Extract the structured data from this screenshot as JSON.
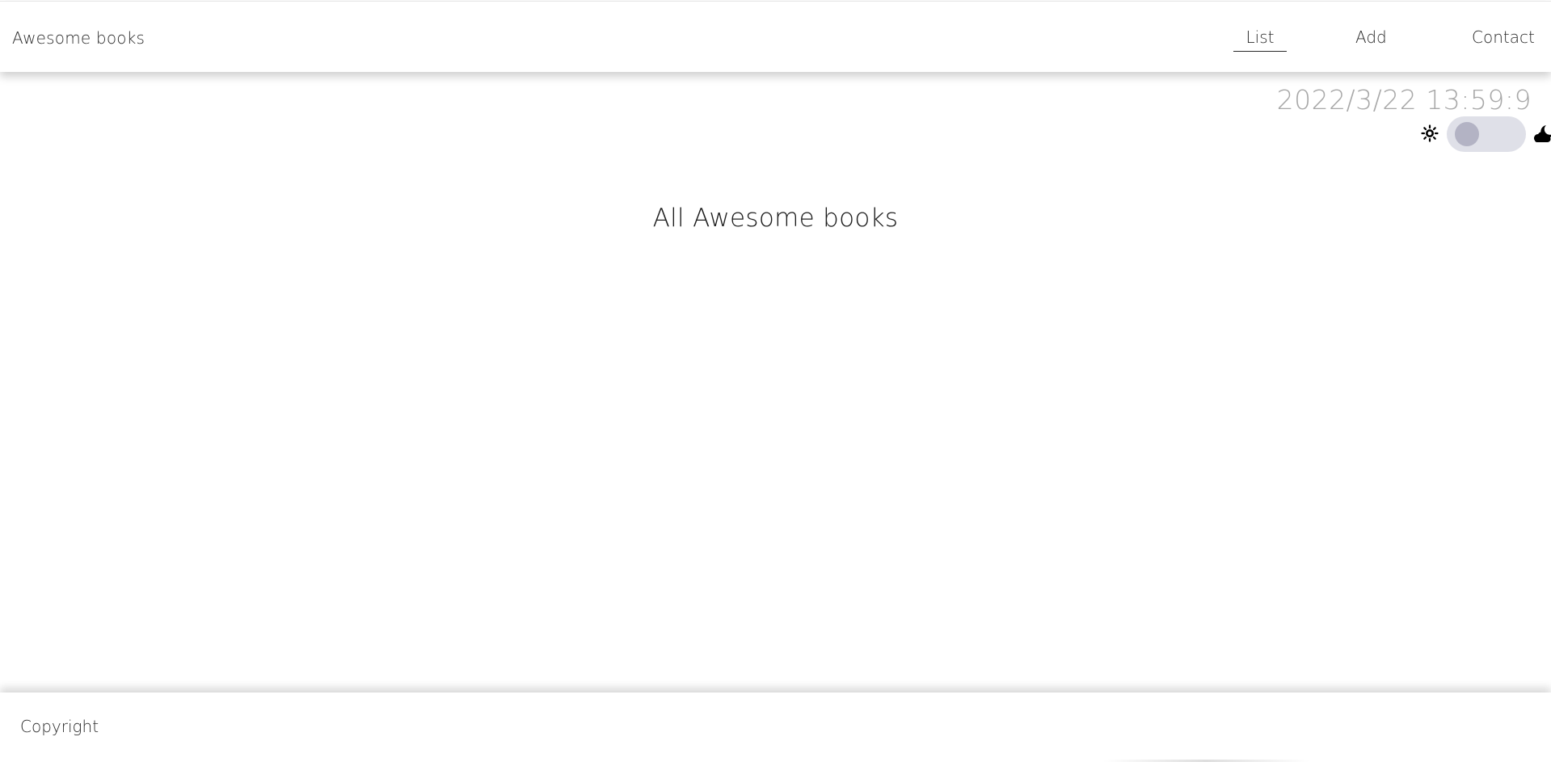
{
  "header": {
    "brand": "Awesome books",
    "nav": {
      "list_label": "List",
      "add_label": "Add",
      "contact_label": "Contact",
      "active": "List"
    }
  },
  "clock": {
    "datetime": "2022/3/22 13:59:9"
  },
  "theme_toggle": {
    "left_icon": "sun-icon",
    "right_icon": "moon-cloud-icon",
    "state": "light"
  },
  "main": {
    "title": "All Awesome books"
  },
  "footer": {
    "copyright": "Copyright"
  },
  "colors": {
    "clock_text": "#a8a8a8",
    "toggle_track": "#dfe0e8",
    "toggle_knob": "#b3b3c4"
  }
}
